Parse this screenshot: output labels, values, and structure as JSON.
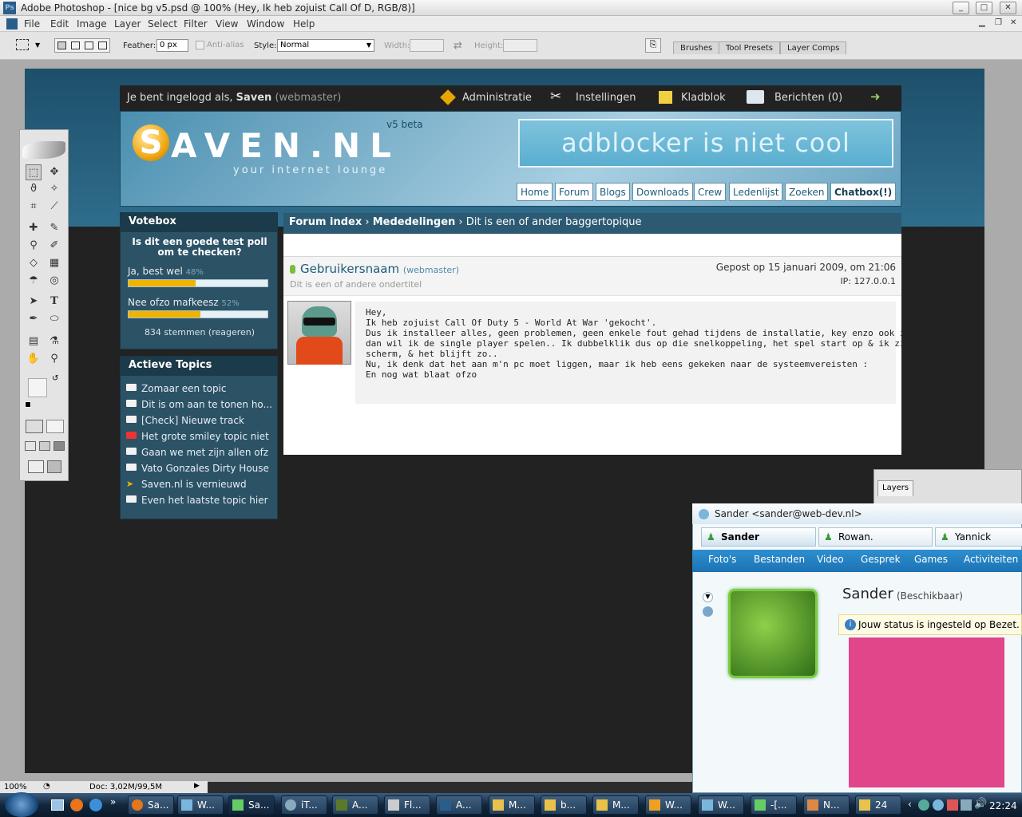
{
  "window": {
    "title": "Adobe Photoshop - [nice bg v5.psd @ 100% (Hey,  Ik heb zojuist Call Of D, RGB/8)]",
    "minimize": "_",
    "maximize": "□",
    "close": "✕"
  },
  "menu": [
    "File",
    "Edit",
    "Image",
    "Layer",
    "Select",
    "Filter",
    "View",
    "Window",
    "Help"
  ],
  "options": {
    "feather_label": "Feather:",
    "feather_value": "0 px",
    "antialias_label": "Anti-alias",
    "style_label": "Style:",
    "style_value": "Normal",
    "width_label": "Width:",
    "height_label": "Height:",
    "panel_tabs": [
      "Brushes",
      "Tool Presets",
      "Layer Comps"
    ]
  },
  "site": {
    "logged_in_prefix": "Je bent ingelogd als, ",
    "username": "Saven",
    "role": "(webmaster)",
    "top_links": [
      "Administratie",
      "Instellingen",
      "Kladblok",
      "Berichten (0)"
    ],
    "logo_letter": "S",
    "logo_rest": "AVEN.NL",
    "version": "v5 beta",
    "tagline": "your internet lounge",
    "banner": "adblocker is niet cool",
    "nav": [
      "Home",
      "Forum",
      "Blogs",
      "Downloads",
      "Crew",
      "Ledenlijst",
      "Zoeken",
      "Chatbox(!)"
    ]
  },
  "votebox": {
    "title": "Votebox",
    "question": "Is dit een goede test poll om te checken?",
    "options": [
      {
        "label": "Ja, best wel",
        "pct": "48%",
        "value": 0.48
      },
      {
        "label": "Nee ofzo mafkeesz",
        "pct": "52%",
        "value": 0.52
      }
    ],
    "total": "834 stemmen (reageren)"
  },
  "topics": {
    "title": "Actieve Topics",
    "items": [
      "Zomaar een topic",
      "Dit is om aan te tonen ho...",
      "[Check] Nieuwe track",
      "Het grote smiley topic niet",
      "Gaan we met zijn allen ofz",
      "Vato Gonzales Dirty House",
      "Saven.nl is vernieuwd",
      "Even het laatste topic hier"
    ]
  },
  "forum": {
    "crumb_1": "Forum index",
    "crumb_sep": " › ",
    "crumb_2": "Mededelingen",
    "crumb_3": "Dit is een of ander baggertopique",
    "author": "Gebruikersnaam",
    "author_role": "(webmaster)",
    "subtitle": "Dit is een of andere ondertitel",
    "posted": "Gepost op 15 januari 2009, om 21:06",
    "ip": "IP: 127.0.0.1",
    "body": [
      "Hey,",
      "",
      "Ik heb zojuist Call Of Duty 5 - World At War 'gekocht'.",
      "Dus ik installeer alles, geen problemen, geen enkele fout gehad tijdens de installatie, key enzo ook in orde, maar",
      "dan wil ik de single player spelen.. Ik dubbelklik dus op die snelkoppeling, het spel start op & ik zie een zwart",
      "scherm, & het blijft zo..",
      "Nu, ik denk dat het aan m'n pc moet liggen, maar ik heb eens gekeken naar de systeemvereisten :",
      "En nog wat blaat ofzo"
    ]
  },
  "status": {
    "zoom": "100%",
    "doc": "Doc: 3,02M/99,5M"
  },
  "layers": {
    "tab": "Layers"
  },
  "messenger": {
    "title": "Sander <sander@web-dev.nl>",
    "tabs": [
      "Sander",
      "Rowan.",
      "Yannick"
    ],
    "nav": [
      "Foto's",
      "Bestanden",
      "Video",
      "Gesprek",
      "Games",
      "Activiteiten"
    ],
    "contact_name": "Sander",
    "contact_status": "(Beschikbaar)",
    "info": "Jouw status is ingesteld op Bezet."
  },
  "taskbar": {
    "items": [
      "Sa...",
      "W...",
      "Sa...",
      "iT...",
      "A...",
      "Fl...",
      "A...",
      "M...",
      "b...",
      "M...",
      "W...",
      "W...",
      "-[...",
      "N...",
      "24"
    ],
    "clock": "22:24"
  },
  "colors": {
    "accent": "#2c5a73",
    "poll_fill": "#f0b400",
    "msn_pink": "#e2468a"
  }
}
